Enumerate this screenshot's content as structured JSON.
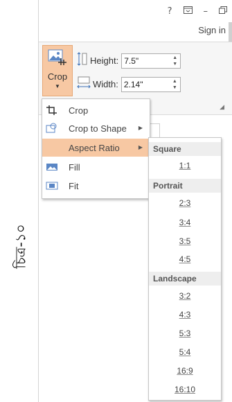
{
  "caption": "চিত্র-১০",
  "window": {
    "help_icon": "?",
    "ribbon_display_icon": "ribbon-display-options-icon",
    "minimize_icon": "–",
    "restore_icon": "restore-icon",
    "sign_in": "Sign in"
  },
  "ribbon": {
    "crop_label": "Crop",
    "height_label": "Height:",
    "height_value": "7.5\"",
    "width_label": "Width:",
    "width_value": "2.14\""
  },
  "crop_menu": {
    "items": [
      {
        "label": "Crop",
        "icon": "crop-icon",
        "submenu": false
      },
      {
        "label": "Crop to Shape",
        "icon": "crop-to-shape-icon",
        "submenu": true
      },
      {
        "label": "Aspect Ratio",
        "icon": "",
        "submenu": true,
        "active": true
      },
      {
        "label": "Fill",
        "icon": "fill-icon",
        "submenu": false
      },
      {
        "label": "Fit",
        "icon": "fit-icon",
        "submenu": false
      }
    ]
  },
  "aspect_menu": {
    "square_header": "Square",
    "square": [
      "1:1"
    ],
    "portrait_header": "Portrait",
    "portrait": [
      "2:3",
      "3:4",
      "3:5",
      "4:5"
    ],
    "landscape_header": "Landscape",
    "landscape": [
      "3:2",
      "4:3",
      "5:3",
      "5:4",
      "16:9",
      "16:10"
    ]
  },
  "colors": {
    "active_highlight": "#f7c8a3",
    "section_header_bg": "#eeeeee"
  }
}
